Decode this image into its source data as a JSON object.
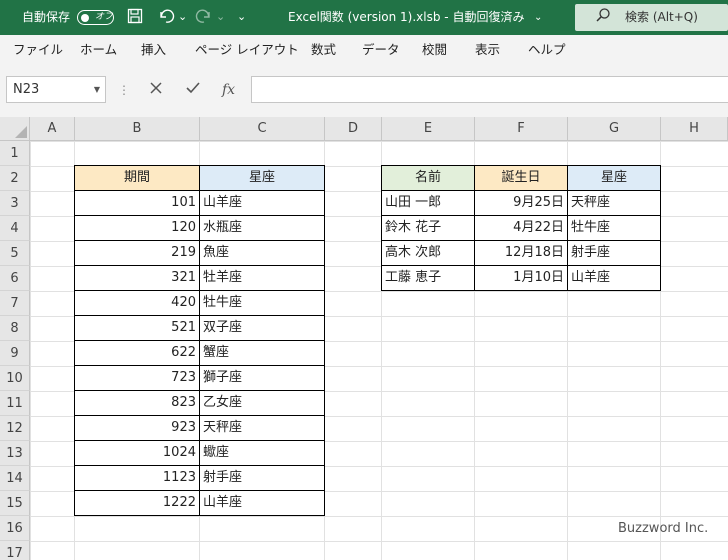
{
  "titlebar": {
    "autosave_label": "自動保存",
    "autosave_state": "オフ",
    "document_title": "Excel関数 (version 1).xlsb  -  自動回復済み",
    "title_chevron": "⌄",
    "search_label": "検索 (Alt+Q)",
    "undo_dropdown": "⌄",
    "redo_dropdown": "⌄",
    "customize_label": "⌄"
  },
  "ribbon": {
    "tabs": [
      "ファイル",
      "ホーム",
      "挿入",
      "ページ レイアウト",
      "数式",
      "データ",
      "校閲",
      "表示",
      "ヘルプ"
    ]
  },
  "formula_bar": {
    "name_box": "N23",
    "fx_label": "fx",
    "formula_value": ""
  },
  "columns": [
    "A",
    "B",
    "C",
    "D",
    "E",
    "F",
    "G",
    "H"
  ],
  "rows": [
    "1",
    "2",
    "3",
    "4",
    "5",
    "6",
    "7",
    "8",
    "9",
    "10",
    "11",
    "12",
    "13",
    "14",
    "15",
    "16",
    "17"
  ],
  "table1": {
    "headers": [
      "期間",
      "星座"
    ],
    "rows": [
      [
        "101",
        "山羊座"
      ],
      [
        "120",
        "水瓶座"
      ],
      [
        "219",
        "魚座"
      ],
      [
        "321",
        "牡羊座"
      ],
      [
        "420",
        "牡牛座"
      ],
      [
        "521",
        "双子座"
      ],
      [
        "622",
        "蟹座"
      ],
      [
        "723",
        "獅子座"
      ],
      [
        "823",
        "乙女座"
      ],
      [
        "923",
        "天秤座"
      ],
      [
        "1024",
        "蠍座"
      ],
      [
        "1123",
        "射手座"
      ],
      [
        "1222",
        "山羊座"
      ]
    ]
  },
  "table2": {
    "headers": [
      "名前",
      "誕生日",
      "星座"
    ],
    "rows": [
      [
        "山田 一郎",
        "9月25日",
        "天秤座"
      ],
      [
        "鈴木 花子",
        "4月22日",
        "牡牛座"
      ],
      [
        "高木 次郎",
        "12月18日",
        "射手座"
      ],
      [
        "工藤 恵子",
        "1月10日",
        "山羊座"
      ]
    ]
  },
  "watermark": "Buzzword Inc.",
  "colors": {
    "title_green": "#217346",
    "header_orange": "#fde9c4",
    "header_blue": "#ddebf7",
    "header_green": "#e2efda"
  }
}
